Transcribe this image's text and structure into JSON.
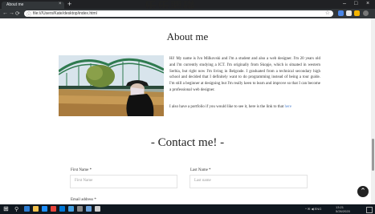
{
  "browser": {
    "tab_title": "About me",
    "tab_close": "×",
    "new_tab": "+",
    "watermark": "乐乐要碰",
    "win_min": "–",
    "win_max": "□",
    "win_close": "×",
    "url": "file:///Users/Kate/desktop/index.html",
    "nav_back": "←",
    "nav_forward": "→",
    "nav_reload": "⟳",
    "star": "☆"
  },
  "page": {
    "about_title": "About me",
    "about_paragraph_1": "Hi! My name is Ivo Milkovski and I'm a student and also a web designer. I'm 20 years old and I'm currently studying a ICT. I'm originally from Skopje, which is situated in western Serbia, but right now I'm living in Belgrade. I graduated from a technical secondary high school and decided that I definitely want to do programming instead of being a tour guide. I'm still a beginner at designing but I'm really keen to learn and improve so that I can become a professional web designer.",
    "about_paragraph_2_text": "I also have a portfolio if you would like to see it, here is the link to that ",
    "about_paragraph_2_link": "here",
    "contact_title": "- Contact me! -",
    "first_name_label": "First Name *",
    "first_name_placeholder": "First Name",
    "last_name_label": "Last Name *",
    "last_name_placeholder": "Last name",
    "email_label": "Email address *",
    "scroll_top_icon": "⌃"
  },
  "taskbar": {
    "tray_text": "^ ✉ ◀ ENG",
    "time": "13:21",
    "date": "5/26/2020"
  },
  "colors": {
    "link": "#5b8bd3",
    "taskbar": "#101820",
    "browser_chrome": "#323639"
  }
}
